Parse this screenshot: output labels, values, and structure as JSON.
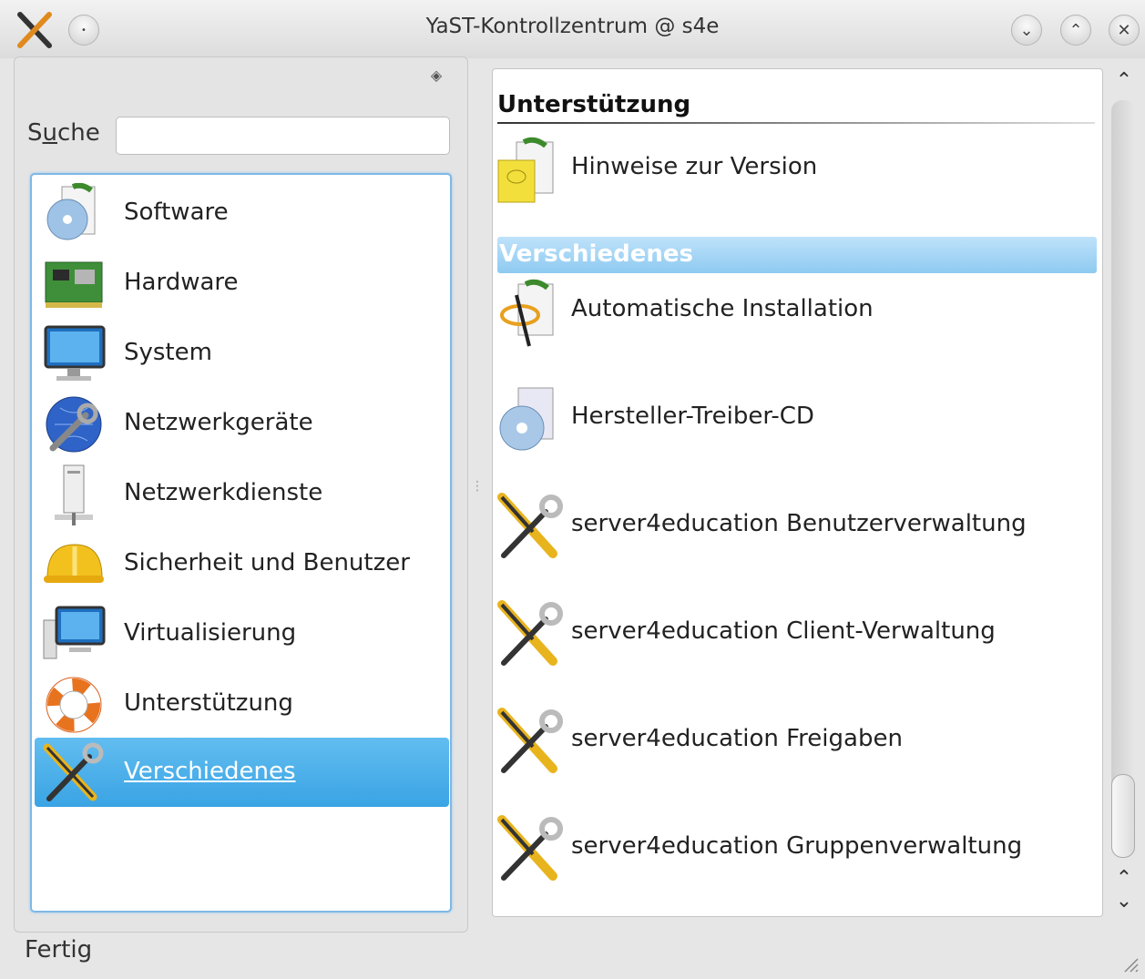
{
  "window": {
    "title": "YaST-Kontrollzentrum @ s4e"
  },
  "search": {
    "label_pre": "S",
    "label_u": "u",
    "label_post": "che",
    "value": ""
  },
  "categories": [
    {
      "label": "Software",
      "icon": "software-icon",
      "selected": false
    },
    {
      "label": "Hardware",
      "icon": "hardware-icon",
      "selected": false
    },
    {
      "label": "System",
      "icon": "system-icon",
      "selected": false
    },
    {
      "label": "Netzwerkgeräte",
      "icon": "network-devices-icon",
      "selected": false
    },
    {
      "label": "Netzwerkdienste",
      "icon": "network-services-icon",
      "selected": false
    },
    {
      "label": "Sicherheit und Benutzer",
      "icon": "security-users-icon",
      "selected": false
    },
    {
      "label": "Virtualisierung",
      "icon": "virtualization-icon",
      "selected": false
    },
    {
      "label": "Unterstützung",
      "icon": "support-icon",
      "selected": false
    },
    {
      "label": "Verschiedenes",
      "icon": "misc-icon",
      "selected": true
    }
  ],
  "sections": [
    {
      "title": "Unterstützung",
      "active": false,
      "modules": [
        {
          "label": "Hinweise zur Version",
          "icon": "release-notes-icon"
        }
      ]
    },
    {
      "title": "Verschiedenes",
      "active": true,
      "modules": [
        {
          "label": "Automatische Installation",
          "icon": "autoinstall-icon"
        },
        {
          "label": "Hersteller-Treiber-CD",
          "icon": "driver-cd-icon"
        },
        {
          "label": "server4education Benutzerverwaltung",
          "icon": "tools-icon"
        },
        {
          "label": "server4education Client-Verwaltung",
          "icon": "tools-icon"
        },
        {
          "label": "server4education Freigaben",
          "icon": "tools-icon"
        },
        {
          "label": "server4education Gruppenverwaltung",
          "icon": "tools-icon"
        }
      ]
    }
  ],
  "status": {
    "text": "Fertig"
  },
  "colors": {
    "selection": "#3aa4e4",
    "active_section": "#8ecaf1",
    "list_border": "#7fb8e5"
  }
}
